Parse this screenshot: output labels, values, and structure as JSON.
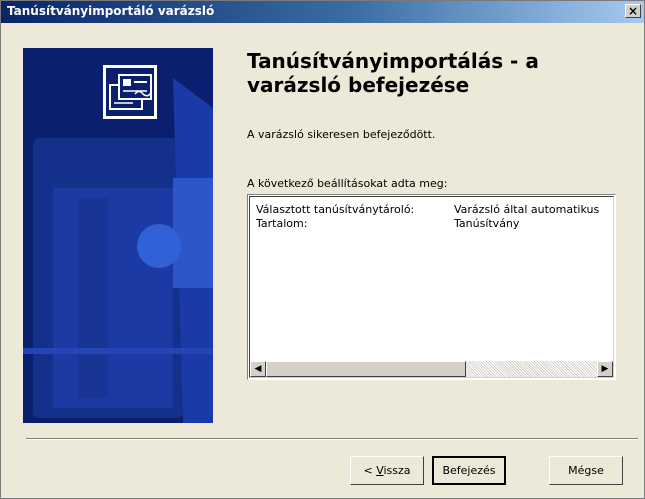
{
  "window": {
    "title": "Tanúsítványimportáló varázsló",
    "close_glyph": "×"
  },
  "banner": {
    "icon": "certificate-icon",
    "bg_color": "#0a1f6d"
  },
  "main": {
    "heading_line1": "Tanúsítványimportálás - a",
    "heading_line2": "varázsló befejezése",
    "status": "A varázsló sikeresen befejeződött.",
    "list_label": "A következő beállításokat adta meg:"
  },
  "settings": [
    {
      "key": "Választott tanúsítványtároló:",
      "value": "Varázsló által automatikus"
    },
    {
      "key": "Tartalom:",
      "value": "Tanúsítvány"
    }
  ],
  "scrollbar": {
    "left_glyph": "◀",
    "right_glyph": "▶"
  },
  "buttons": {
    "back_prefix": "< ",
    "back_underlined": "V",
    "back_rest": "issza",
    "finish": "Befejezés",
    "cancel": "Mégse"
  }
}
